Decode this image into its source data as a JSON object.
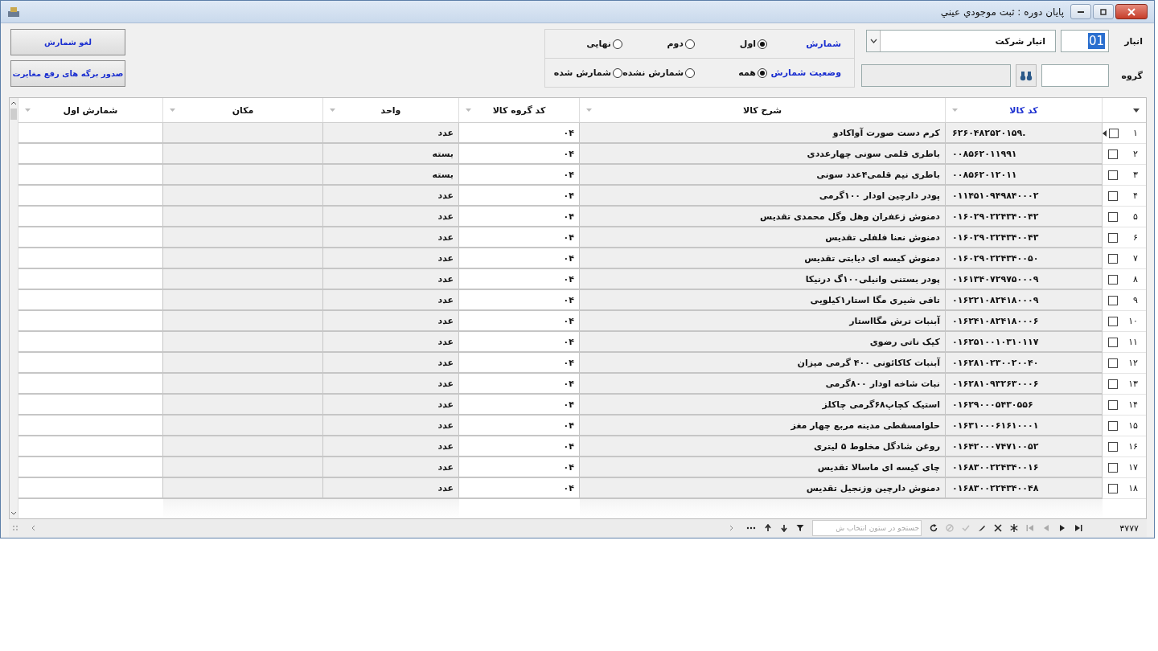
{
  "window": {
    "title": "پایان دوره : ثبت موجودي عيني"
  },
  "warehouse": {
    "label": "انبار",
    "code": "01",
    "name": "انبار شرکت"
  },
  "group": {
    "label": "گروه"
  },
  "count_round": {
    "label": "شمارش",
    "options": [
      {
        "label": "اول",
        "selected": true
      },
      {
        "label": "دوم",
        "selected": false
      },
      {
        "label": "نهایی",
        "selected": false
      }
    ]
  },
  "count_status": {
    "label": "وضعیت شمارش",
    "options": [
      {
        "label": "همه",
        "selected": true
      },
      {
        "label": "شمارش نشده",
        "selected": false
      },
      {
        "label": "شمارش شده",
        "selected": false
      }
    ]
  },
  "buttons": [
    {
      "label": "لغو شمارش"
    },
    {
      "label": "صدور برگه های رفع مغایرت"
    }
  ],
  "table": {
    "columns": [
      {
        "label": "کد کالا",
        "active": true
      },
      {
        "label": "شرح کالا",
        "active": false
      },
      {
        "label": "کد گروه کالا",
        "active": false
      },
      {
        "label": "واحد",
        "active": false
      },
      {
        "label": "مکان",
        "active": false
      },
      {
        "label": "شمارش اول",
        "active": false
      }
    ],
    "rows": [
      {
        "number": "۱",
        "checked": false,
        "current": true,
        "cells": [
          "۶۲۶۰۴۸۲۵۲۰۱۵۹.",
          "کرم دست صورت آواکادو",
          "۰۴",
          "عدد"
        ]
      },
      {
        "number": "۲",
        "checked": false,
        "current": false,
        "cells": [
          "۰۰۸۵۶۲۰۱۱۹۹۱",
          "باطری قلمی سونی چهارعددی",
          "۰۴",
          "بسته"
        ]
      },
      {
        "number": "۳",
        "checked": false,
        "current": false,
        "cells": [
          "۰۰۸۵۶۲۰۱۲۰۱۱",
          "باطری نیم قلمی۴عدد سونی",
          "۰۴",
          "بسته"
        ]
      },
      {
        "number": "۴",
        "checked": false,
        "current": false,
        "cells": [
          "۰۱۱۴۵۱۰۹۴۹۸۴۰۰۰۲",
          "پودر دارچین اودار ۱۰۰گرمی",
          "۰۴",
          "عدد"
        ]
      },
      {
        "number": "۵",
        "checked": false,
        "current": false,
        "cells": [
          "۰۱۶۰۲۹۰۲۲۴۳۴۰۰۴۲",
          "دمنوش زعفران وهل وگل محمدی تقدیس",
          "۰۴",
          "عدد"
        ]
      },
      {
        "number": "۶",
        "checked": false,
        "current": false,
        "cells": [
          "۰۱۶۰۲۹۰۲۲۴۳۴۰۰۴۳",
          "دمنوش نعنا فلفلی تقدیس",
          "۰۴",
          "عدد"
        ]
      },
      {
        "number": "۷",
        "checked": false,
        "current": false,
        "cells": [
          "۰۱۶۰۲۹۰۲۲۴۳۴۰۰۵۰",
          "دمنوش کیسه ای دیابتی تقدیس",
          "۰۴",
          "عدد"
        ]
      },
      {
        "number": "۸",
        "checked": false,
        "current": false,
        "cells": [
          "۰۱۶۱۳۴۰۷۲۹۷۵۰۰۰۹",
          "پودر بستنی وانیلی۱۰۰گ درنیکا",
          "۰۴",
          "عدد"
        ]
      },
      {
        "number": "۹",
        "checked": false,
        "current": false,
        "cells": [
          "۰۱۶۲۲۱۰۸۲۴۱۸۰۰۰۹",
          "تافی شیری مگا استار۱کیلویی",
          "۰۴",
          "عدد"
        ]
      },
      {
        "number": "۱۰",
        "checked": false,
        "current": false,
        "cells": [
          "۰۱۶۲۴۱۰۸۲۴۱۸۰۰۰۶",
          "آبنبات ترش مگااستار",
          "۰۴",
          "عدد"
        ]
      },
      {
        "number": "۱۱",
        "checked": false,
        "current": false,
        "cells": [
          "۰۱۶۲۵۱۰۰۱۰۳۱۰۱۱۷",
          "کیک ناتی رضوی",
          "۰۴",
          "عدد"
        ]
      },
      {
        "number": "۱۲",
        "checked": false,
        "current": false,
        "cells": [
          "۰۱۶۲۸۱۰۲۳۰۰۲۰۰۴۰",
          "آبنبات کاکائونی ۴۰۰ گرمی میزان",
          "۰۴",
          "عدد"
        ]
      },
      {
        "number": "۱۳",
        "checked": false,
        "current": false,
        "cells": [
          "۰۱۶۲۸۱۰۹۳۲۶۳۰۰۰۶",
          "نبات شاخه اودار ۸۰۰گرمی",
          "۰۴",
          "عدد"
        ]
      },
      {
        "number": "۱۴",
        "checked": false,
        "current": false,
        "cells": [
          "۰۱۶۲۹۰۰۰۵۴۳۰۵۵۶",
          "استیک کچاپ۶۸گرمی چاکلز",
          "۰۴",
          "عدد"
        ]
      },
      {
        "number": "۱۵",
        "checked": false,
        "current": false,
        "cells": [
          "۰۱۶۳۱۰۰۰۶۱۶۱۰۰۰۱",
          "حلوامسقطی مدینه مربع چهار مغز",
          "۰۴",
          "عدد"
        ]
      },
      {
        "number": "۱۶",
        "checked": false,
        "current": false,
        "cells": [
          "۰۱۶۴۲۰۰۰۷۴۷۱۰۰۵۲",
          "روغن شادگل مخلوط ۵ لیتری",
          "۰۴",
          "عدد"
        ]
      },
      {
        "number": "۱۷",
        "checked": false,
        "current": false,
        "cells": [
          "۰۱۶۸۳۰۰۲۲۴۳۴۰۰۱۶",
          "چای کیسه ای ماسالا تقدیس",
          "۰۴",
          "عدد"
        ]
      },
      {
        "number": "۱۸",
        "checked": false,
        "current": false,
        "cells": [
          "۰۱۶۸۳۰۰۲۲۴۳۴۰۰۴۸",
          "دمنوش دارچین وزنجیل تقدیس",
          "۰۴",
          "عدد"
        ]
      }
    ]
  },
  "footer": {
    "record_count": "۳۷۷۷",
    "search_placeholder": "جستجو در ستون انتخاب ش"
  }
}
